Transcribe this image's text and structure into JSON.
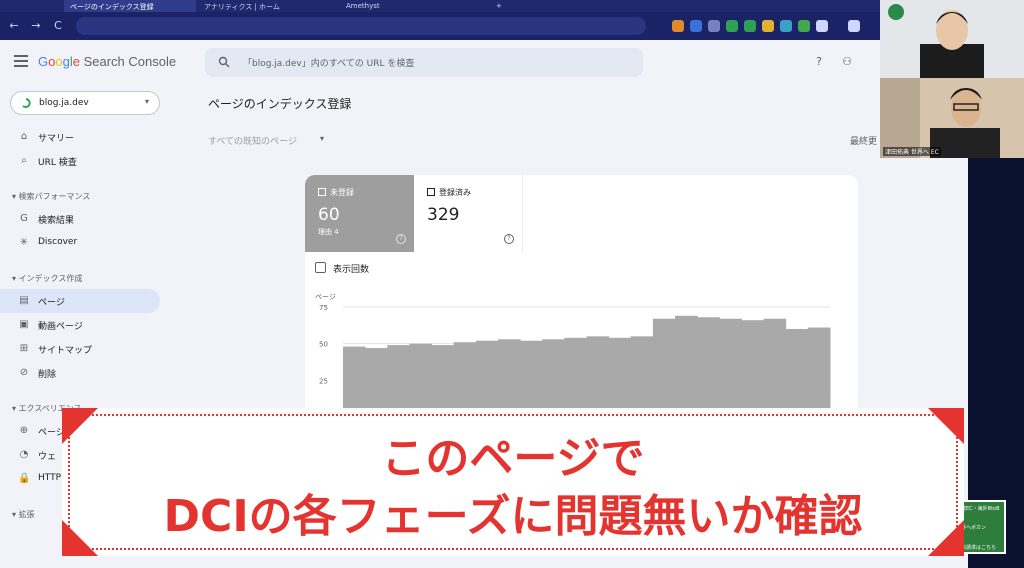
{
  "browser": {
    "tabs": [
      {
        "label": "ページのインデックス登録",
        "active": true
      },
      {
        "label": "アナリティクス | ホーム",
        "active": false
      },
      {
        "label": "Amethyst",
        "active": false
      }
    ],
    "nav": {
      "back": "←",
      "forward": "→",
      "reload": "C"
    },
    "new_tab": "+"
  },
  "gsc": {
    "logo_parts": [
      "G",
      "o",
      "o",
      "g",
      "l",
      "e"
    ],
    "logo_suffix": " Search Console",
    "search_placeholder": "「blog.ja.dev」内のすべての URL を検査",
    "property": "blog.ja.dev",
    "sidebar": {
      "top_items": [
        {
          "icon": "⌂",
          "label": "サマリー"
        },
        {
          "icon": "⌕",
          "label": "URL 検査"
        }
      ],
      "section_performance": "検索パフォーマンス",
      "performance_items": [
        {
          "icon": "G",
          "label": "検索結果"
        },
        {
          "icon": "✳",
          "label": "Discover"
        }
      ],
      "section_index": "インデックス作成",
      "index_items": [
        {
          "icon": "▤",
          "label": "ページ"
        },
        {
          "icon": "▣",
          "label": "動画ページ"
        },
        {
          "icon": "⊞",
          "label": "サイトマップ"
        },
        {
          "icon": "⊘",
          "label": "削除"
        }
      ],
      "section_experience": "エクスペリエンス",
      "experience_items": [
        {
          "icon": "⊕",
          "label": "ページ"
        },
        {
          "icon": "◔",
          "label": "ウェ"
        },
        {
          "icon": "🔒",
          "label": "HTTP"
        }
      ],
      "section_extensions": "拡張"
    },
    "page_title": "ページのインデックス登録",
    "filter_label": "すべての既知のページ",
    "last_update": "最終更",
    "stats": {
      "unregistered": {
        "label": "未登録",
        "value": "60",
        "sub": "理由 4"
      },
      "registered": {
        "label": "登録済み",
        "value": "329"
      }
    },
    "impressions_label": "表示回数"
  },
  "chart_data": {
    "type": "bar",
    "ylabel": "ページ",
    "ylim": [
      0,
      75
    ],
    "yticks": [
      "75",
      "50",
      "25",
      "0"
    ],
    "values": [
      48,
      47,
      49,
      50,
      49,
      51,
      52,
      53,
      52,
      53,
      54,
      55,
      54,
      55,
      67,
      69,
      68,
      67,
      66,
      67,
      60,
      61
    ]
  },
  "cams": {
    "cam1_tag": "",
    "cam2_tag": "津田拓典 世界へ EC"
  },
  "badge": {
    "line1": "越境EC・海外BtoB",
    "line2": "世界へボカン",
    "line3": "資料請求はこちら"
  },
  "caption": {
    "line1": "このページで",
    "line2": "DCIの各フェーズに問題無いか確認"
  }
}
